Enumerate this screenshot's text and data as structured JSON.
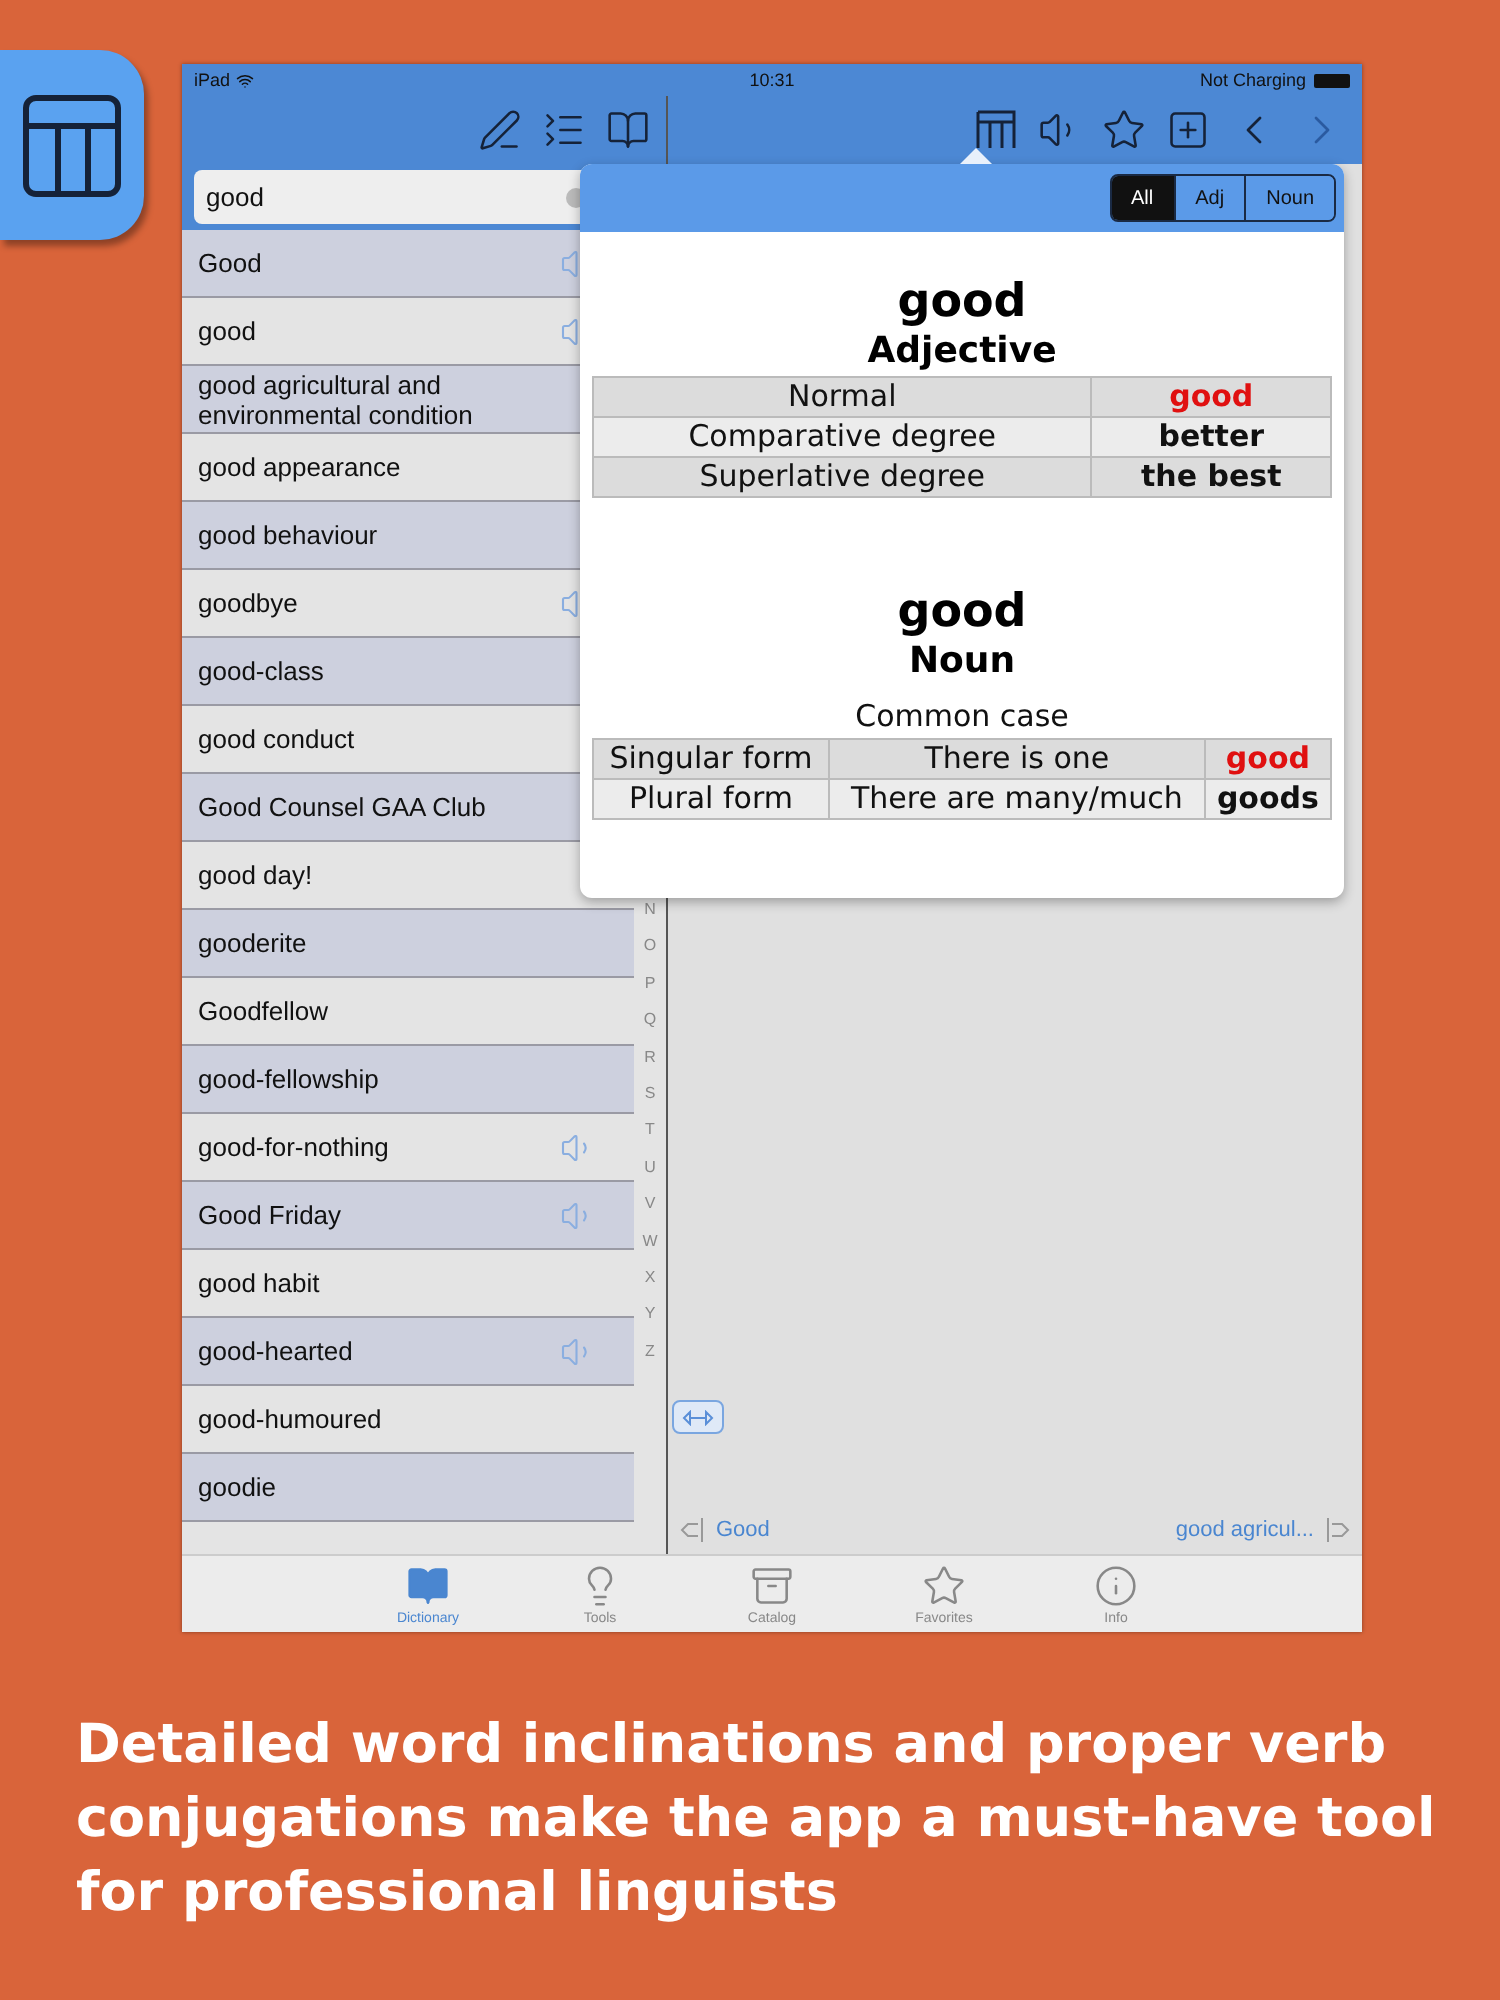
{
  "status_bar": {
    "device": "iPad",
    "time": "10:31",
    "charging": "Not Charging"
  },
  "search": {
    "value": "good"
  },
  "word_list": [
    {
      "word": "Good",
      "audio": true
    },
    {
      "word": "good",
      "audio": true
    },
    {
      "word": "good agricultural and environmental condition",
      "audio": false
    },
    {
      "word": "good appearance",
      "audio": false
    },
    {
      "word": "good behaviour",
      "audio": false
    },
    {
      "word": "goodbye",
      "audio": true
    },
    {
      "word": "good-class",
      "audio": false
    },
    {
      "word": "good conduct",
      "audio": false
    },
    {
      "word": "Good Counsel GAA Club",
      "audio": false
    },
    {
      "word": "good day!",
      "audio": false
    },
    {
      "word": "gooderite",
      "audio": false
    },
    {
      "word": "Goodfellow",
      "audio": false
    },
    {
      "word": "good-fellowship",
      "audio": false
    },
    {
      "word": "good-for-nothing",
      "audio": true
    },
    {
      "word": "Good Friday",
      "audio": true
    },
    {
      "word": "good habit",
      "audio": false
    },
    {
      "word": "good-hearted",
      "audio": true
    },
    {
      "word": "good-humoured",
      "audio": false
    },
    {
      "word": "goodie",
      "audio": false
    }
  ],
  "index_letters": [
    "N",
    "O",
    "P",
    "Q",
    "R",
    "S",
    "T",
    "U",
    "V",
    "W",
    "X",
    "Y",
    "Z"
  ],
  "popover": {
    "filters": [
      {
        "label": "All",
        "selected": true
      },
      {
        "label": "Adj",
        "selected": false
      },
      {
        "label": "Noun",
        "selected": false
      }
    ],
    "sections": [
      {
        "headword": "good",
        "part_of_speech": "Adjective",
        "rows": [
          {
            "cells": [
              "Normal"
            ],
            "form": "good",
            "highlight": true
          },
          {
            "cells": [
              "Comparative degree"
            ],
            "form": "better",
            "highlight": false
          },
          {
            "cells": [
              "Superlative degree"
            ],
            "form": "the best",
            "highlight": false
          }
        ]
      },
      {
        "headword": "good",
        "part_of_speech": "Noun",
        "case": "Common case",
        "rows": [
          {
            "cells": [
              "Singular form",
              "There is one"
            ],
            "form": "good",
            "highlight": true
          },
          {
            "cells": [
              "Plural form",
              "There are many/much"
            ],
            "form": "goods",
            "highlight": false
          }
        ]
      }
    ]
  },
  "navigation": {
    "previous": "Good",
    "next": "good agricul..."
  },
  "tab_bar": [
    {
      "label": "Dictionary",
      "selected": true
    },
    {
      "label": "Tools",
      "selected": false
    },
    {
      "label": "Catalog",
      "selected": false
    },
    {
      "label": "Favorites",
      "selected": false
    },
    {
      "label": "Info",
      "selected": false
    }
  ],
  "caption": "Detailed word inclinations and proper verb conjugations make the app a must-have tool for professional linguists"
}
